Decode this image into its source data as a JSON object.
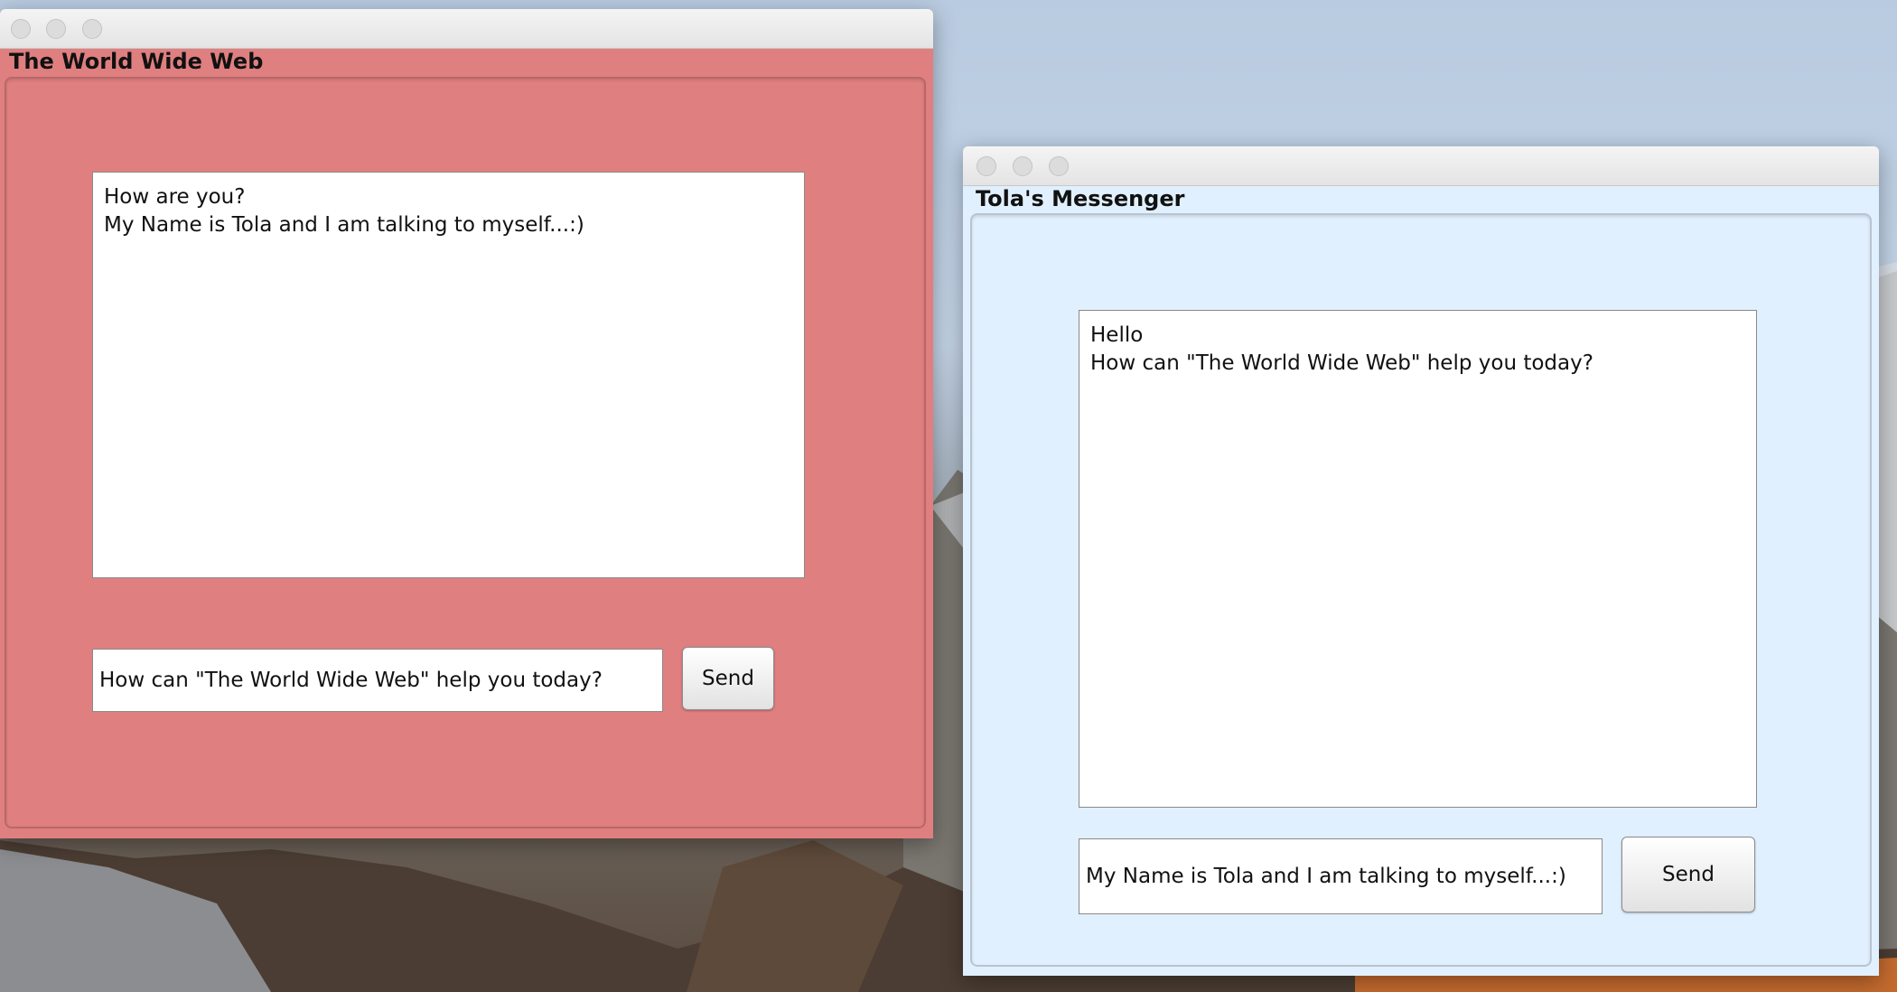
{
  "colors": {
    "left_window_bg": "#e07f80",
    "right_window_bg": "#e1f0fe"
  },
  "left_window": {
    "title": "The World Wide Web",
    "chat_lines": [
      "How are you?",
      "My Name is Tola and I am talking to myself...:)"
    ],
    "input_value": "How can \"The World Wide Web\" help you today?",
    "send_label": "Send"
  },
  "right_window": {
    "title": "Tola's Messenger",
    "chat_lines": [
      "Hello",
      "How can \"The World Wide Web\" help you today?"
    ],
    "input_value": "My Name is Tola and I am talking to myself...:)",
    "send_label": "Send"
  }
}
